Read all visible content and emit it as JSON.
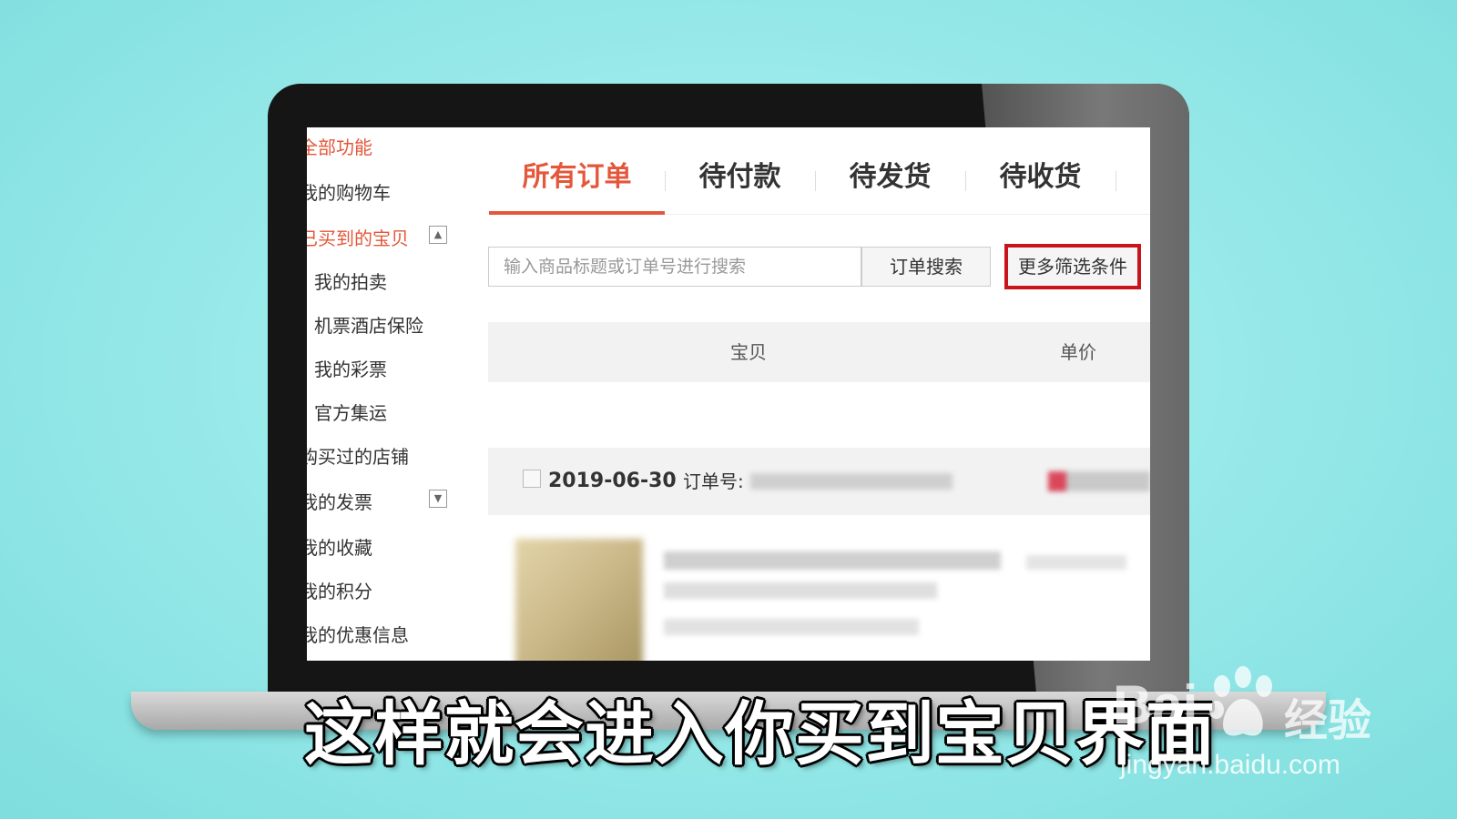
{
  "sidebar": {
    "title": "全部功能",
    "items": [
      {
        "label": "我的购物车"
      },
      {
        "label": "已买到的宝贝"
      },
      {
        "label": "我的拍卖"
      },
      {
        "label": "机票酒店保险"
      },
      {
        "label": "我的彩票"
      },
      {
        "label": "官方集运"
      },
      {
        "label": "购买过的店铺"
      },
      {
        "label": "我的发票"
      },
      {
        "label": "我的收藏"
      },
      {
        "label": "我的积分"
      },
      {
        "label": "我的优惠信息"
      }
    ],
    "toggle_up": "▲",
    "toggle_down": "▼"
  },
  "tabs": [
    {
      "label": "所有订单",
      "active": true
    },
    {
      "label": "待付款"
    },
    {
      "label": "待发货"
    },
    {
      "label": "待收货"
    }
  ],
  "search": {
    "placeholder": "输入商品标题或订单号进行搜索",
    "button_label": "订单搜索",
    "more_filters_label": "更多筛选条件"
  },
  "table": {
    "columns": [
      "宝贝",
      "单价"
    ]
  },
  "order": {
    "date": "2019-06-30",
    "order_no_label": "订单号:"
  },
  "subtitle": "这样就会进入你买到宝贝界面",
  "watermark": {
    "logo_text": "Bai",
    "logo_suffix": "经验",
    "url": "jingyan.baidu.com"
  },
  "colors": {
    "accent": "#e4573a",
    "highlight_border": "#c8141c"
  }
}
